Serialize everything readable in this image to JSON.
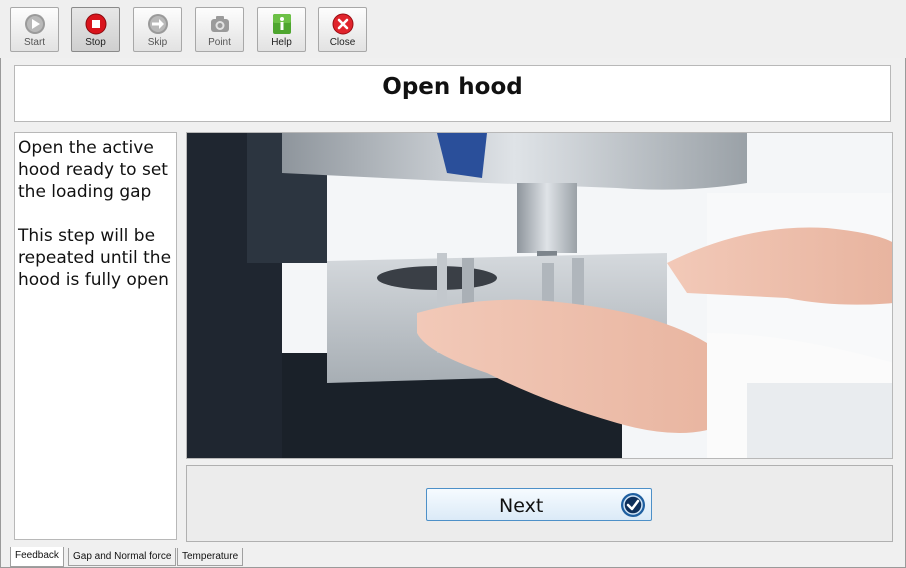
{
  "toolbar": {
    "start_label": "Start",
    "stop_label": "Stop",
    "skip_label": "Skip",
    "point_label": "Point",
    "help_label": "Help",
    "close_label": "Close"
  },
  "step": {
    "title": "Open hood",
    "instruction": "Open the active hood ready to set the loading gap",
    "note": "This step will be repeated until the hood is fully open"
  },
  "buttons": {
    "next_label": "Next"
  },
  "tabs": [
    "Feedback",
    "Gap and Normal force",
    "Temperature"
  ],
  "colors": {
    "stop_red": "#d9141c",
    "help_green": "#4ea62f",
    "close_red": "#e0242c",
    "next_border": "#4d90c8",
    "next_icon": "#1f5fa0"
  },
  "icons": {
    "start": "play-icon",
    "stop": "stop-icon",
    "skip": "skip-icon",
    "point": "camera-icon",
    "help": "info-icon",
    "close": "close-icon",
    "next": "checkmark-icon"
  }
}
